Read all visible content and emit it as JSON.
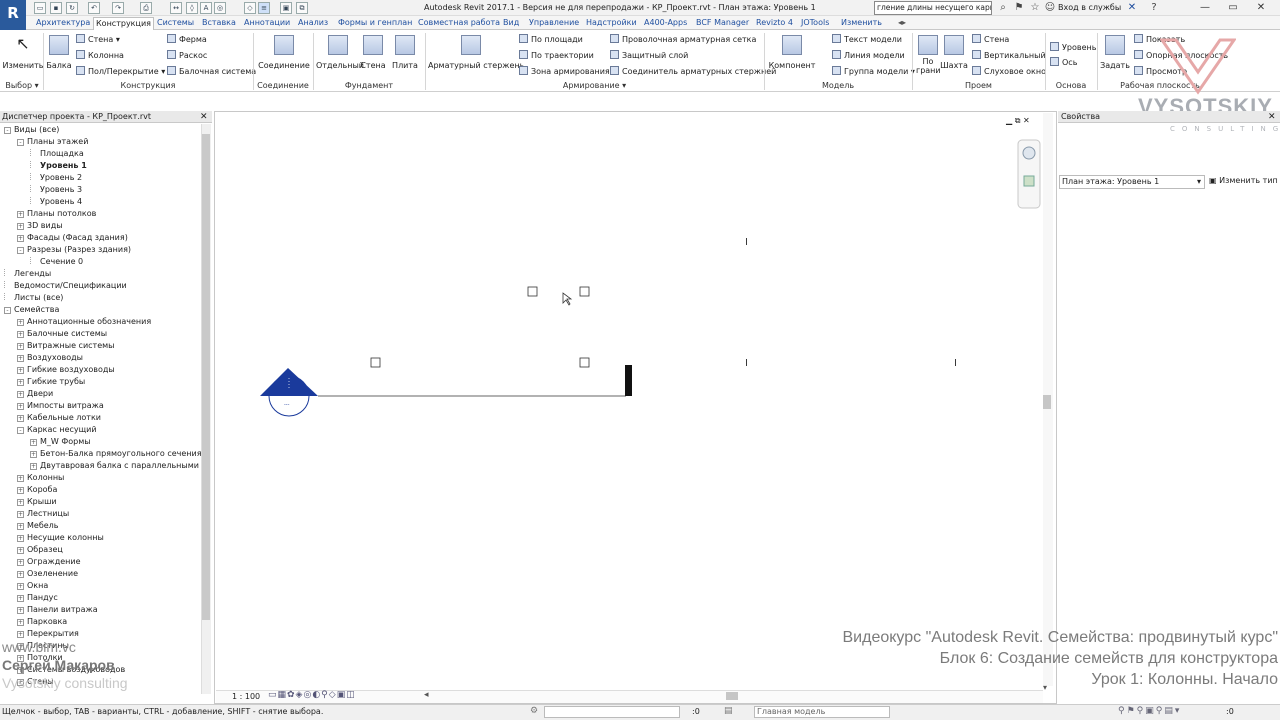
{
  "titlebar": {
    "window_title": "Autodesk Revit 2017.1 - Версия не для перепродажи -    КР_Проект.rvt - План этажа: Уровень 1",
    "search_value": "гление длины несущего каркаса",
    "signin_label": "Вход в службы",
    "app_letter": "R"
  },
  "tabs": [
    "Архитектура",
    "Конструкция",
    "Системы",
    "Вставка",
    "Аннотации",
    "Анализ",
    "Формы и генплан",
    "Совместная работа",
    "Вид",
    "Управление",
    "Надстройки",
    "A400-Apps",
    "BCF Manager",
    "Revizto 4",
    "JOTools",
    "Изменить"
  ],
  "ribbon": {
    "select": {
      "modify": "Изменить",
      "panel": "Выбор"
    },
    "structure": {
      "beam": "Балка",
      "wall": "Стена",
      "column": "Колонна",
      "floor": "Пол/Перекрытие",
      "truss": "Ферма",
      "brace": "Раскос",
      "beam_system": "Балочная система",
      "panel": "Конструкция"
    },
    "connection": {
      "connection": "Соединение",
      "panel": "Соединение"
    },
    "foundation": {
      "isolated": "Отдельный",
      "wall": "Стена",
      "slab": "Плита",
      "panel": "Фундамент"
    },
    "reinforcement": {
      "rebar": "Арматурный стержень",
      "area": "По площади",
      "path": "По траектории",
      "area_zone": "Зона армирования",
      "fabric": "Проволочная арматурная сетка",
      "cover": "Защитный слой",
      "coupler": "Соединитель арматурных стержней",
      "panel": "Армирование"
    },
    "model": {
      "component": "Компонент",
      "model_text": "Текст модели",
      "model_line": "Линия модели",
      "model_group": "Группа модели",
      "panel": "Модель"
    },
    "opening": {
      "by_face": "По грани",
      "shaft": "Шахта",
      "wall": "Стена",
      "vertical": "Вертикальный",
      "dormer": "Слуховое окно",
      "panel": "Проем"
    },
    "datum": {
      "level": "Уровень",
      "grid": "Ось",
      "panel": "Основа"
    },
    "workplane": {
      "set": "Задать",
      "show": "Показать",
      "ref_plane": "Опорная плоскость",
      "viewer": "Просмотр",
      "panel": "Рабочая плоскость"
    }
  },
  "watermark": {
    "brand": "VYSOTSKIY",
    "sub": "CONSULTING"
  },
  "project_browser": {
    "title": "Диспетчер проекта - КР_Проект.rvt",
    "items": [
      {
        "label": "Виды (все)",
        "level": 0,
        "exp": "-"
      },
      {
        "label": "Планы этажей",
        "level": 1,
        "exp": "-"
      },
      {
        "label": "Площадка",
        "level": 2,
        "exp": ""
      },
      {
        "label": "Уровень 1",
        "level": 2,
        "exp": "",
        "bold": true
      },
      {
        "label": "Уровень 2",
        "level": 2,
        "exp": ""
      },
      {
        "label": "Уровень 3",
        "level": 2,
        "exp": ""
      },
      {
        "label": "Уровень 4",
        "level": 2,
        "exp": ""
      },
      {
        "label": "Планы потолков",
        "level": 1,
        "exp": "+"
      },
      {
        "label": "3D виды",
        "level": 1,
        "exp": "+"
      },
      {
        "label": "Фасады (Фасад здания)",
        "level": 1,
        "exp": "+"
      },
      {
        "label": "Разрезы (Разрез здания)",
        "level": 1,
        "exp": "-"
      },
      {
        "label": "Сечение 0",
        "level": 2,
        "exp": ""
      },
      {
        "label": "Легенды",
        "level": 0,
        "exp": ""
      },
      {
        "label": "Ведомости/Спецификации",
        "level": 0,
        "exp": ""
      },
      {
        "label": "Листы (все)",
        "level": 0,
        "exp": ""
      },
      {
        "label": "Семейства",
        "level": 0,
        "exp": "-"
      },
      {
        "label": "Аннотационные обозначения",
        "level": 1,
        "exp": "+"
      },
      {
        "label": "Балочные системы",
        "level": 1,
        "exp": "+"
      },
      {
        "label": "Витражные системы",
        "level": 1,
        "exp": "+"
      },
      {
        "label": "Воздуховоды",
        "level": 1,
        "exp": "+"
      },
      {
        "label": "Гибкие воздуховоды",
        "level": 1,
        "exp": "+"
      },
      {
        "label": "Гибкие трубы",
        "level": 1,
        "exp": "+"
      },
      {
        "label": "Двери",
        "level": 1,
        "exp": "+"
      },
      {
        "label": "Импосты витража",
        "level": 1,
        "exp": "+"
      },
      {
        "label": "Кабельные лотки",
        "level": 1,
        "exp": "+"
      },
      {
        "label": "Каркас несущий",
        "level": 1,
        "exp": "-"
      },
      {
        "label": "M_W Формы",
        "level": 2,
        "exp": "+"
      },
      {
        "label": "Бетон-Балка прямоугольного сечения",
        "level": 2,
        "exp": "+"
      },
      {
        "label": "Двутавровая балка с параллельными гран",
        "level": 2,
        "exp": "+"
      },
      {
        "label": "Колонны",
        "level": 1,
        "exp": "+"
      },
      {
        "label": "Короба",
        "level": 1,
        "exp": "+"
      },
      {
        "label": "Крыши",
        "level": 1,
        "exp": "+"
      },
      {
        "label": "Лестницы",
        "level": 1,
        "exp": "+"
      },
      {
        "label": "Мебель",
        "level": 1,
        "exp": "+"
      },
      {
        "label": "Несущие колонны",
        "level": 1,
        "exp": "+"
      },
      {
        "label": "Образец",
        "level": 1,
        "exp": "+"
      },
      {
        "label": "Ограждение",
        "level": 1,
        "exp": "+"
      },
      {
        "label": "Озеленение",
        "level": 1,
        "exp": "+"
      },
      {
        "label": "Окна",
        "level": 1,
        "exp": "+"
      },
      {
        "label": "Пандус",
        "level": 1,
        "exp": "+"
      },
      {
        "label": "Панели витража",
        "level": 1,
        "exp": "+"
      },
      {
        "label": "Парковка",
        "level": 1,
        "exp": "+"
      },
      {
        "label": "Перекрытия",
        "level": 1,
        "exp": "+"
      },
      {
        "label": "Пластины",
        "level": 1,
        "exp": "+"
      },
      {
        "label": "Потолки",
        "level": 1,
        "exp": "+"
      },
      {
        "label": "Системы воздуховодов",
        "level": 1,
        "exp": "+"
      },
      {
        "label": "Стены",
        "level": 1,
        "exp": "+"
      }
    ]
  },
  "view": {
    "scale": "1 : 100"
  },
  "properties": {
    "title": "Свойства",
    "type_select": "План этажа: Уровень 1",
    "edit_type": "Изменить тип"
  },
  "status": {
    "hint": "Щелчок - выбор, TAB - варианты, CTRL - добавление, SHIFT - снятие выбора.",
    "count": ":0",
    "model": "Главная модель",
    "filter": ":0"
  },
  "overlay": {
    "course_line1": "Видеокурс \"Autodesk Revit. Семейства: продвинутый курс\"",
    "course_line2": "Блок 6: Создание семейств для конструктора",
    "course_line3": "Урок 1: Колонны. Начало",
    "site": "www.bim.vc",
    "author": "Сергей Макаров",
    "company": "Vysotskiy consulting"
  },
  "colors": {
    "accent": "#2050a0",
    "level_marker": "#1a3a9c"
  }
}
